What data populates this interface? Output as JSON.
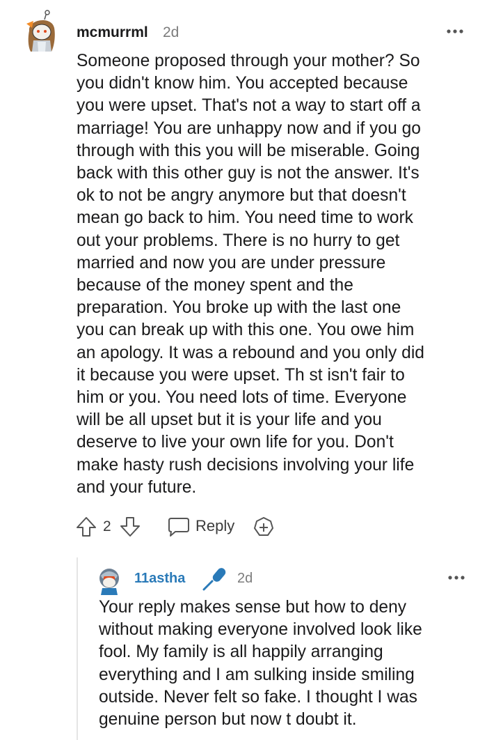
{
  "comment": {
    "username": "mcmurrml",
    "time": "2d",
    "avatar_icon": "snoo-avatar-icon",
    "body": "Someone proposed through your mother? So\nyou didn't know him. You accepted because\nyou were upset. That's not a way to start off a\nmarriage! You are unhappy now and if you go\nthrough with this you will be miserable. Going\nback with this other guy is not the answer. It's\nok to not be angry anymore but that doesn't\nmean go back to him. You need time to work\nout your problems. There is no hurry to get\nmarried and now you are under pressure\nbecause of the money spent and the\npreparation. You broke up with the last one\nyou can break up with this one. You owe him\nan apology. It was a rebound and you only did\nit because you were upset. Th st isn't fair to\nhim or you. You need lots of time. Everyone\nwill be all upset but it is your life and you\ndeserve to live your own life for you. Don't\nmake hasty rush decisions involving your life\nand your future.",
    "votes": "2",
    "reply_label": "Reply"
  },
  "reply": {
    "username": "11astha",
    "time": "2d",
    "flair_icon": "microphone-icon",
    "accent_color": "#2a7ab8",
    "body": "Your reply makes sense but how to deny\nwithout making everyone involved look like\nfool. My family is all happily arranging\neverything and I am sulking inside smiling\noutside. Never felt so fake. I thought I was\ngenuine person but now t doubt it."
  }
}
